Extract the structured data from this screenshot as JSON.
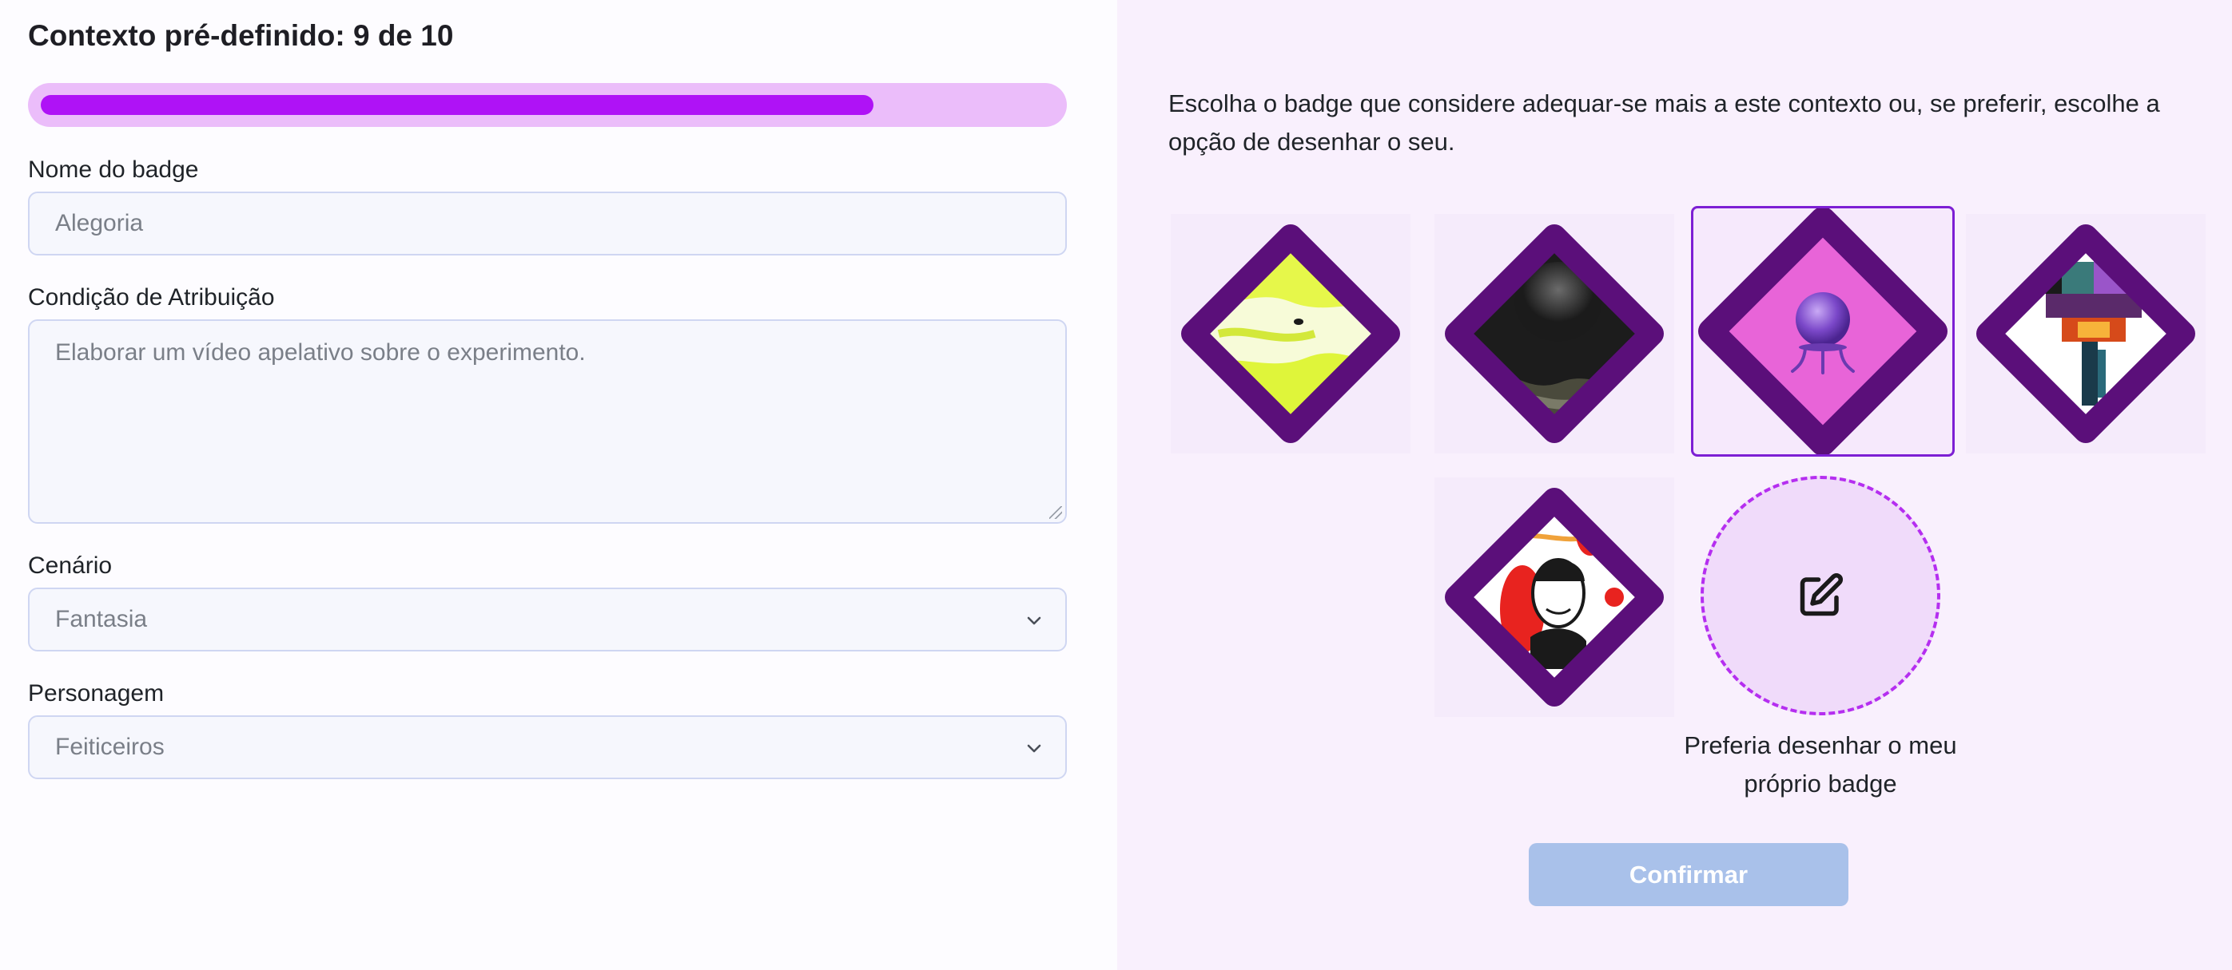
{
  "header": {
    "title": "Contexto pré-definido: 9 de 10",
    "progress_fraction": 0.9
  },
  "form": {
    "badge_name": {
      "label": "Nome do badge",
      "placeholder": "Alegoria"
    },
    "condition": {
      "label": "Condição de Atribuição",
      "placeholder": "Elaborar um vídeo apelativo sobre o experimento."
    },
    "scenario": {
      "label": "Cenário",
      "value": "Fantasia"
    },
    "character": {
      "label": "Personagem",
      "value": "Feiticeiros"
    }
  },
  "picker": {
    "instructions": "Escolha o badge que considere adequar-se mais a este contexto ou, se preferir, escolhe a opção de desenhar o seu.",
    "badges": [
      {
        "name": "badge-yellow-map",
        "selected": false
      },
      {
        "name": "badge-black-smoke",
        "selected": false
      },
      {
        "name": "badge-crystal-ball",
        "selected": true
      },
      {
        "name": "badge-pixel-wizard",
        "selected": false
      },
      {
        "name": "badge-card-portrait",
        "selected": false
      }
    ],
    "draw_own_label": "Preferia desenhar o meu próprio badge",
    "confirm_label": "Confirmar"
  },
  "colors": {
    "accent": "#af12f6",
    "track": "#ebbdfa",
    "badge_frame": "#5b0f7a",
    "confirm_disabled": "#a9c1ea"
  }
}
